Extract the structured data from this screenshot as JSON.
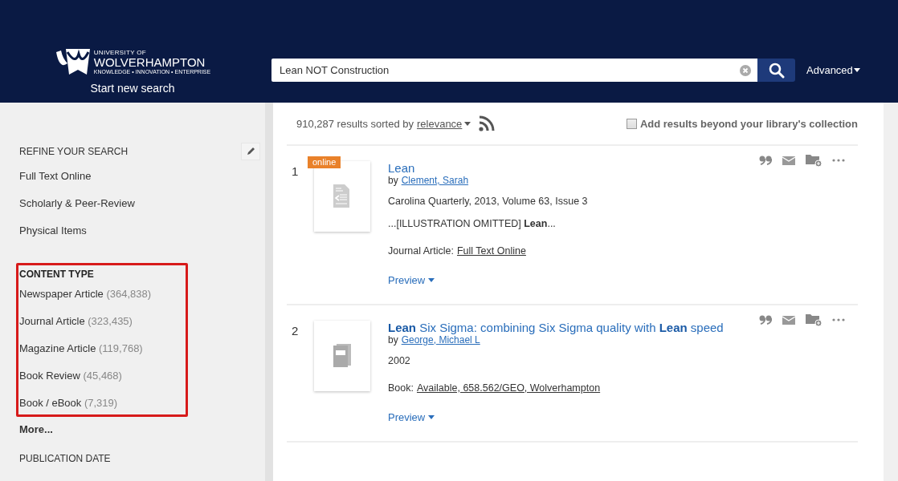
{
  "header": {
    "logo": {
      "line_1": "UNIVERSITY OF",
      "line_2": "WOLVERHAMPTON",
      "line_3": "KNOWLEDGE • INNOVATION • ENTERPRISE"
    },
    "start_link": "Start new search",
    "search": {
      "value": "Lean NOT Construction"
    },
    "advanced": "Advanced"
  },
  "sidebar": {
    "refine_title": "REFINE YOUR SEARCH",
    "refine_items": [
      "Full Text Online",
      "Scholarly & Peer-Review",
      "Physical Items"
    ],
    "content_type": {
      "title": "CONTENT TYPE",
      "highlighted": true,
      "items": [
        {
          "label": "Newspaper Article",
          "count": "(364,838)"
        },
        {
          "label": "Journal Article",
          "count": "(323,435)"
        },
        {
          "label": "Magazine Article",
          "count": "(119,768)"
        },
        {
          "label": "Book Review",
          "count": "(45,468)"
        },
        {
          "label": "Book / eBook",
          "count": "(7,319)"
        }
      ],
      "more": "More..."
    },
    "next_section": "PUBLICATION DATE"
  },
  "results_bar": {
    "summary": "910,287 results sorted by",
    "sort": "relevance",
    "beyond": {
      "label": "Add results beyond your library's collection",
      "checked": false
    }
  },
  "results": [
    {
      "number": "1",
      "kind": "article",
      "badge": "online",
      "title": "Lean",
      "author_prefix": "by",
      "author": "Clement, Sarah",
      "source": "Carolina Quarterly, 2013, Volume 63, Issue 3",
      "snippet": "...[ILLUSTRATION OMITTED] **Lean**...",
      "format": "Journal Article:",
      "availability": "Full Text Online",
      "preview": "Preview"
    },
    {
      "number": "2",
      "kind": "book",
      "title": "**Lean** Six Sigma: combining Six Sigma quality with **Lean** speed",
      "author_prefix": "by",
      "author": "George, Michael L",
      "source": "2002",
      "format": "Book:",
      "availability": "Available, 658.562/GEO, Wolverhampton",
      "preview": "Preview"
    }
  ]
}
